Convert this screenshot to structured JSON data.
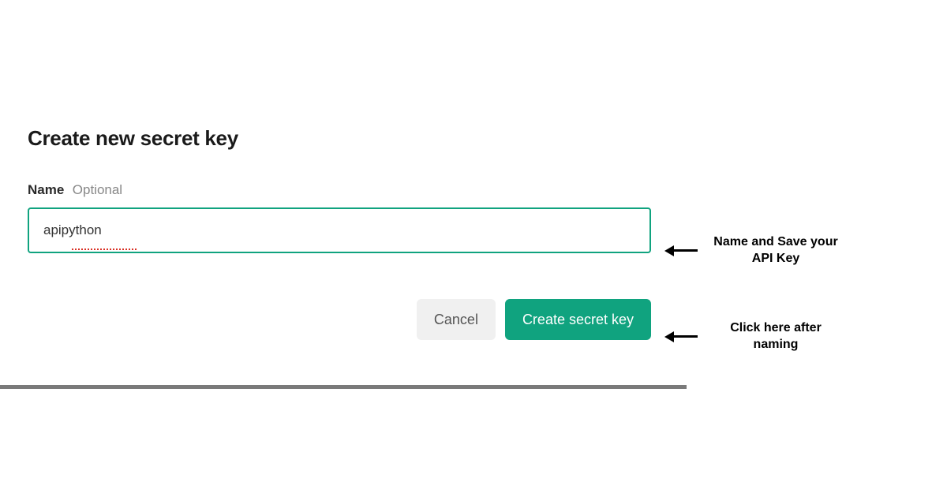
{
  "dialog": {
    "title": "Create new secret key",
    "field": {
      "label": "Name",
      "optional": "Optional",
      "value": "apipython"
    },
    "buttons": {
      "cancel": "Cancel",
      "create": "Create secret key"
    }
  },
  "annotations": {
    "input_hint": "Name and Save your API Key",
    "button_hint": "Click here after naming"
  }
}
